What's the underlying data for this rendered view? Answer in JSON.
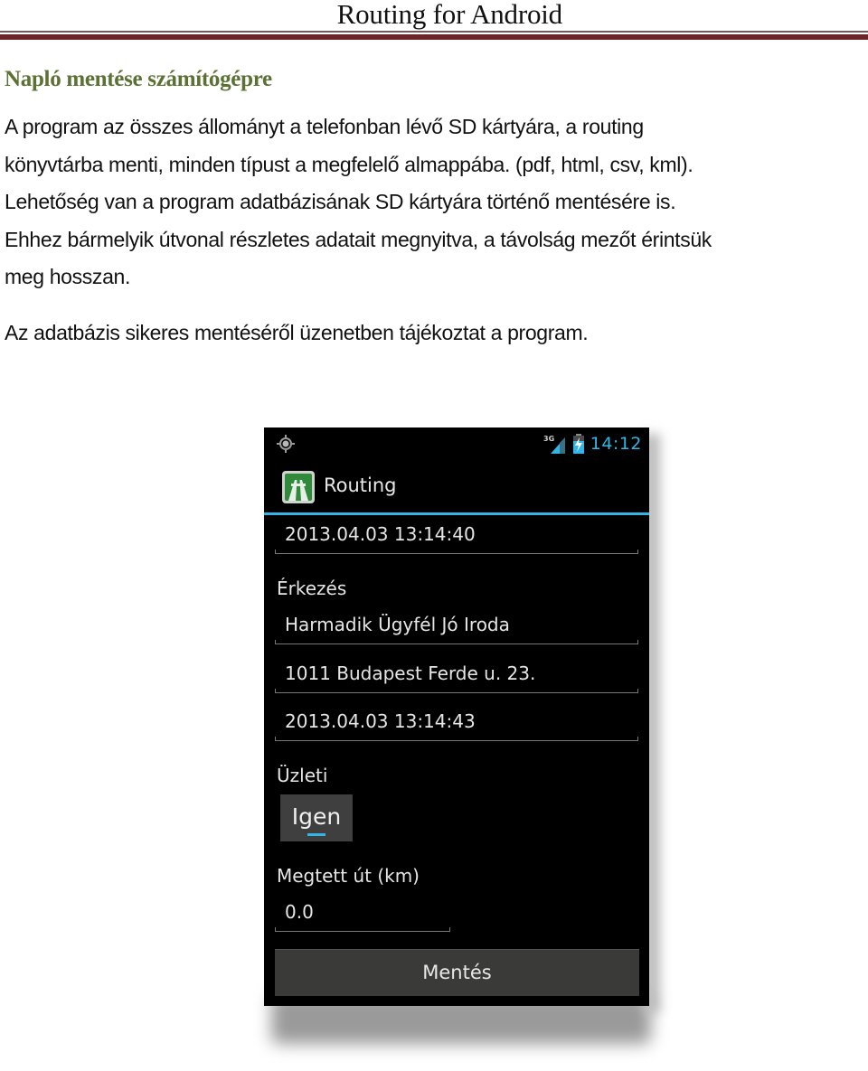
{
  "document": {
    "running_header": "Routing for Android",
    "section_heading": "Napló mentése számítógépre",
    "paragraph_1_lines": [
      "A program az összes állományt a telefonban lévő SD kártyára, a routing",
      "könyvtárba menti, minden típust a megfelelő almappába. (pdf, html, csv, kml).",
      "Lehetőség van a program adatbázisának SD kártyára történő mentésére is.",
      "Ehhez bármelyik útvonal részletes adatait megnyitva, a távolság mezőt érintsük",
      "meg hosszan."
    ],
    "paragraph_2": "Az adatbázis sikeres mentéséről üzenetben tájékoztat a program.",
    "colors": {
      "heading": "#5c7134",
      "rule_thin": "#6e5a58",
      "rule_thick": "#6d2426"
    }
  },
  "phone": {
    "status_bar": {
      "left_icon": "gps-icon",
      "network_label": "3G",
      "signal_icon": "signal-icon",
      "battery_icon": "battery-charging-icon",
      "clock": "14:12"
    },
    "action_bar": {
      "app_icon": "highway-icon",
      "title": "Routing"
    },
    "fields": {
      "departure_time": "2013.04.03 13:14:40",
      "arrival_label": "Érkezés",
      "arrival_name": "Harmadik Ügyfél Jó Iroda",
      "arrival_address": "1011 Budapest Ferde u. 23.",
      "arrival_time": "2013.04.03 13:14:43",
      "business_label": "Üzleti",
      "business_toggle": "Igen",
      "distance_label": "Megtett út (km)",
      "distance_value": "0.0"
    },
    "save_button": "Mentés",
    "colors": {
      "accent": "#33b5e5",
      "background": "#000000",
      "button": "#3a3b38"
    }
  }
}
